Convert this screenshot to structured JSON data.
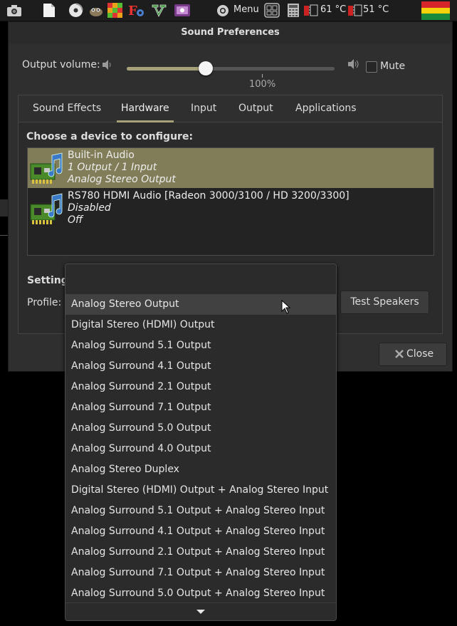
{
  "panel": {
    "menu_label": "Menu",
    "temp1": "61 °C",
    "temp2": "51 °C"
  },
  "dialog": {
    "title": "Sound Preferences",
    "output_volume_label": "Output volume:",
    "volume_percent": "100%",
    "volume_level": 0.38,
    "mute_label": "Mute",
    "tabs": [
      {
        "label": "Sound Effects"
      },
      {
        "label": "Hardware"
      },
      {
        "label": "Input"
      },
      {
        "label": "Output"
      },
      {
        "label": "Applications"
      }
    ],
    "active_tab": "Hardware",
    "device_header": "Choose a device to configure:",
    "devices": [
      {
        "name": "Built-in Audio",
        "line2": "1 Output / 1 Input",
        "line3": "Analog Stereo Output"
      },
      {
        "name": "RS780 HDMI Audio [Radeon 3000/3100 / HD 3200/3300]",
        "line2": "Disabled",
        "line3": "Off"
      }
    ],
    "settings_label": "Setting",
    "profile_label": "Profile:",
    "test_speakers_label": "Test Speakers",
    "close_label": "Close"
  },
  "dropdown": {
    "options": [
      "Analog Stereo Output",
      "Digital Stereo (HDMI) Output",
      "Analog Surround 5.1 Output",
      "Analog Surround 4.1 Output",
      "Analog Surround 2.1 Output",
      "Analog Surround 7.1 Output",
      "Analog Surround 5.0 Output",
      "Analog Surround 4.0 Output",
      "Analog Stereo Duplex",
      "Digital Stereo (HDMI) Output + Analog Stereo Input",
      "Analog Surround 5.1 Output + Analog Stereo Input",
      "Analog Surround 4.1 Output + Analog Stereo Input",
      "Analog Surround 2.1 Output + Analog Stereo Input",
      "Analog Surround 7.1 Output + Analog Stereo Input",
      "Analog Surround 5.0 Output + Analog Stereo Input"
    ],
    "highlighted": "Analog Stereo Output"
  },
  "colors": {
    "accent": "#a6a179",
    "selection": "#827d59"
  }
}
